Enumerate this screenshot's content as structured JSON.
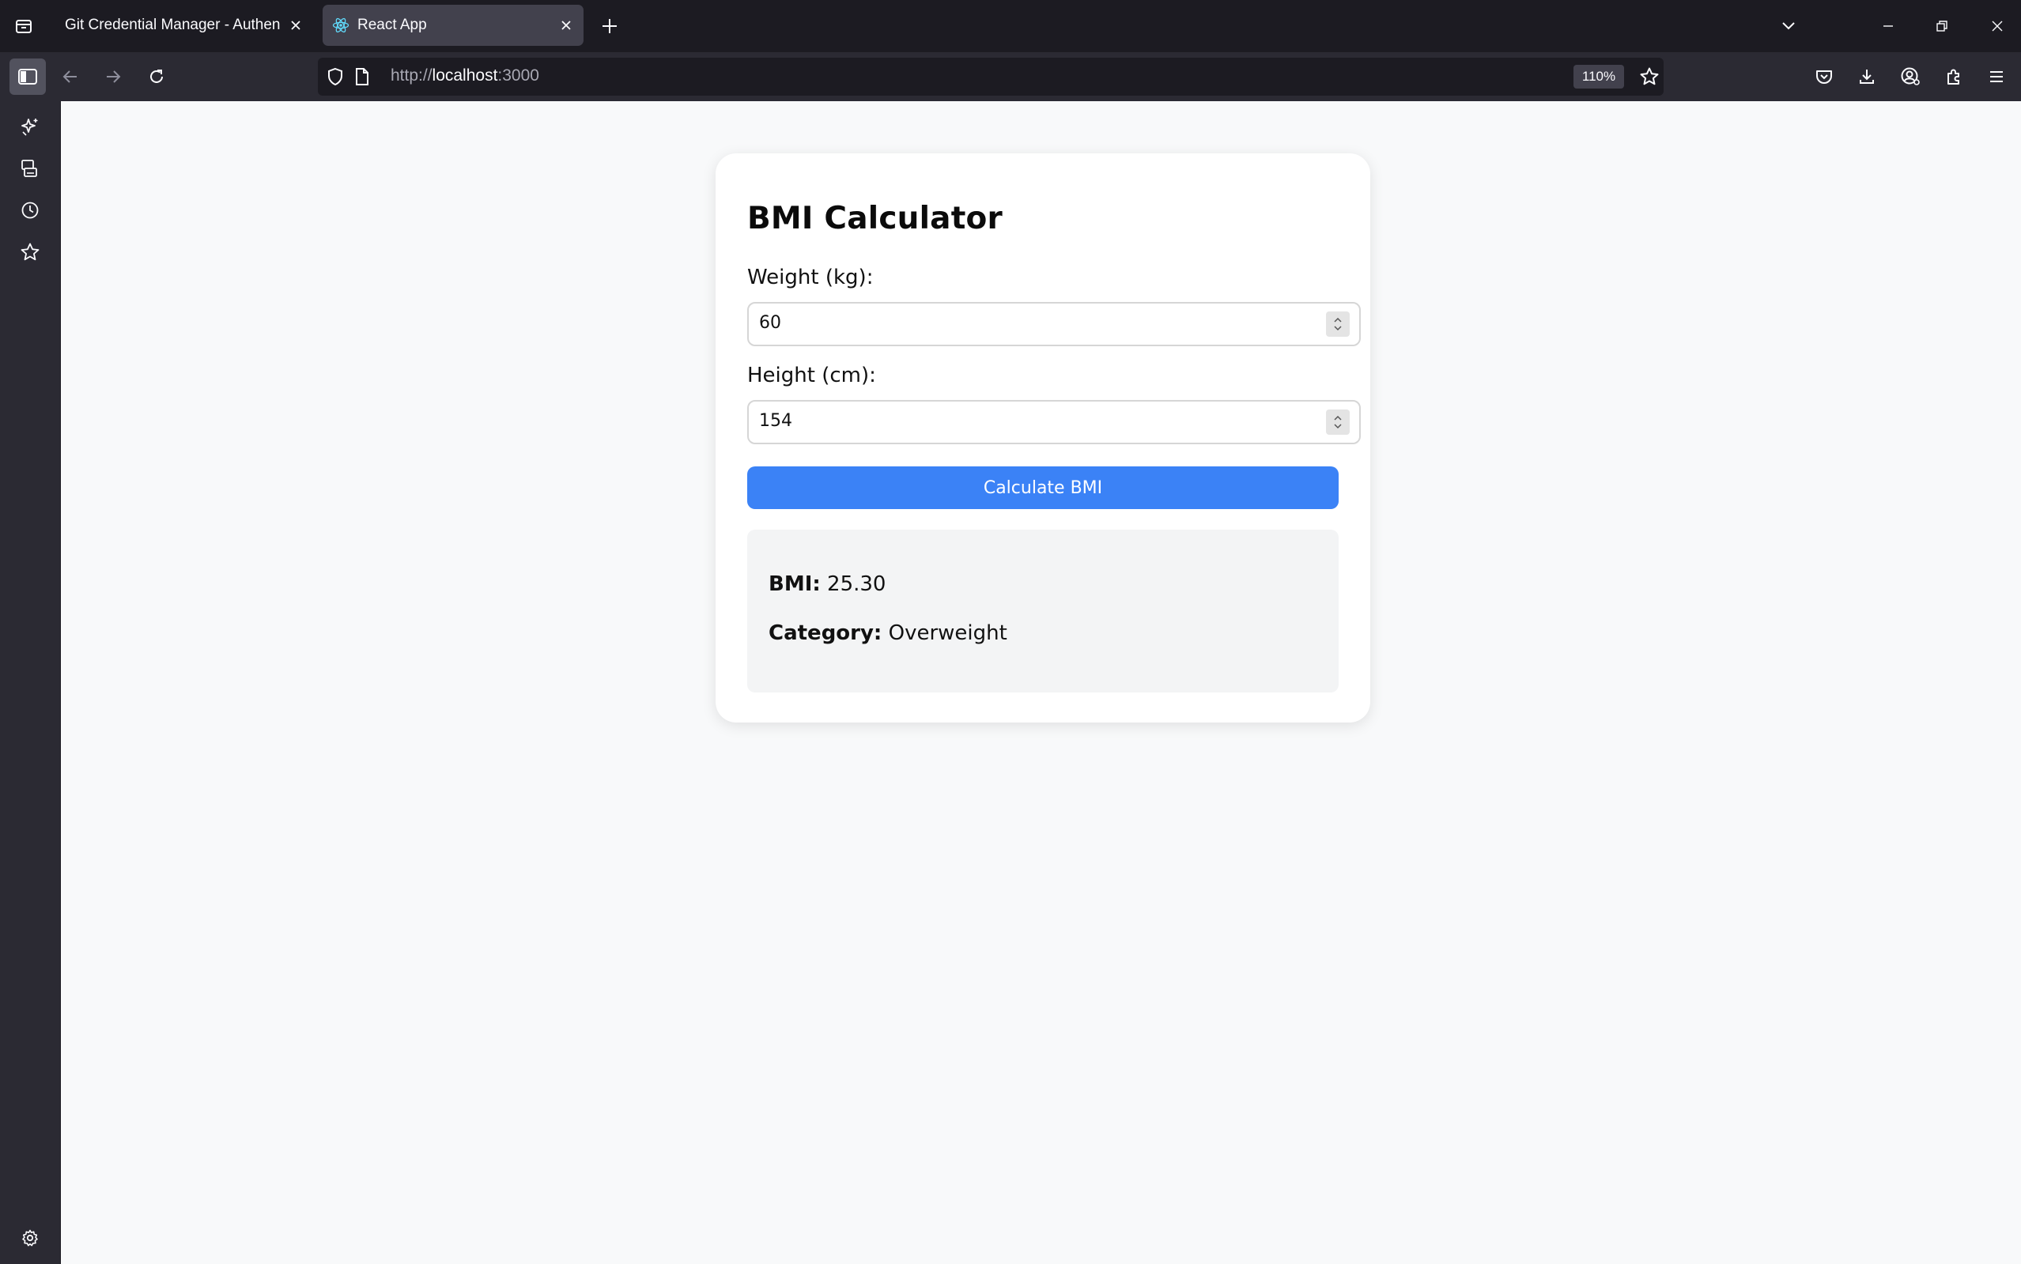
{
  "browser": {
    "tabs": [
      {
        "title": "Git Credential Manager - Authentication",
        "active": false
      },
      {
        "title": "React App",
        "active": true
      }
    ],
    "url": {
      "scheme": "http://",
      "host": "localhost",
      "port": ":3000"
    },
    "zoom": "110%"
  },
  "icons": {
    "tab_list": "tab-list-icon",
    "new_tab": "plus-icon",
    "sidebar_toggle": "sidebar-icon",
    "back": "arrow-left-icon",
    "forward": "arrow-right-icon",
    "reload": "reload-icon",
    "shield": "shield-icon",
    "page": "page-icon",
    "bookmark": "star-icon",
    "pocket": "pocket-icon",
    "downloads": "download-icon",
    "account": "account-icon",
    "extensions": "puzzle-icon",
    "menu": "hamburger-menu-icon",
    "sidebar_items": [
      "ai-sparkle-icon",
      "synced-tabs-icon",
      "history-icon",
      "bookmarks-star-icon"
    ],
    "settings": "gear-icon"
  },
  "app": {
    "title": "BMI Calculator",
    "weight": {
      "label": "Weight (kg):",
      "value": "60"
    },
    "height": {
      "label": "Height (cm):",
      "value": "154"
    },
    "calculate_label": "Calculate BMI",
    "result": {
      "bmi_label": "BMI:",
      "bmi_value": "25.30",
      "category_label": "Category:",
      "category_value": "Overweight"
    }
  },
  "colors": {
    "button": "#3b82f6",
    "page_bg": "#f8f9fa",
    "result_bg": "#f3f4f5",
    "browser_chrome": "#1c1b22",
    "toolbar": "#2b2a33"
  }
}
